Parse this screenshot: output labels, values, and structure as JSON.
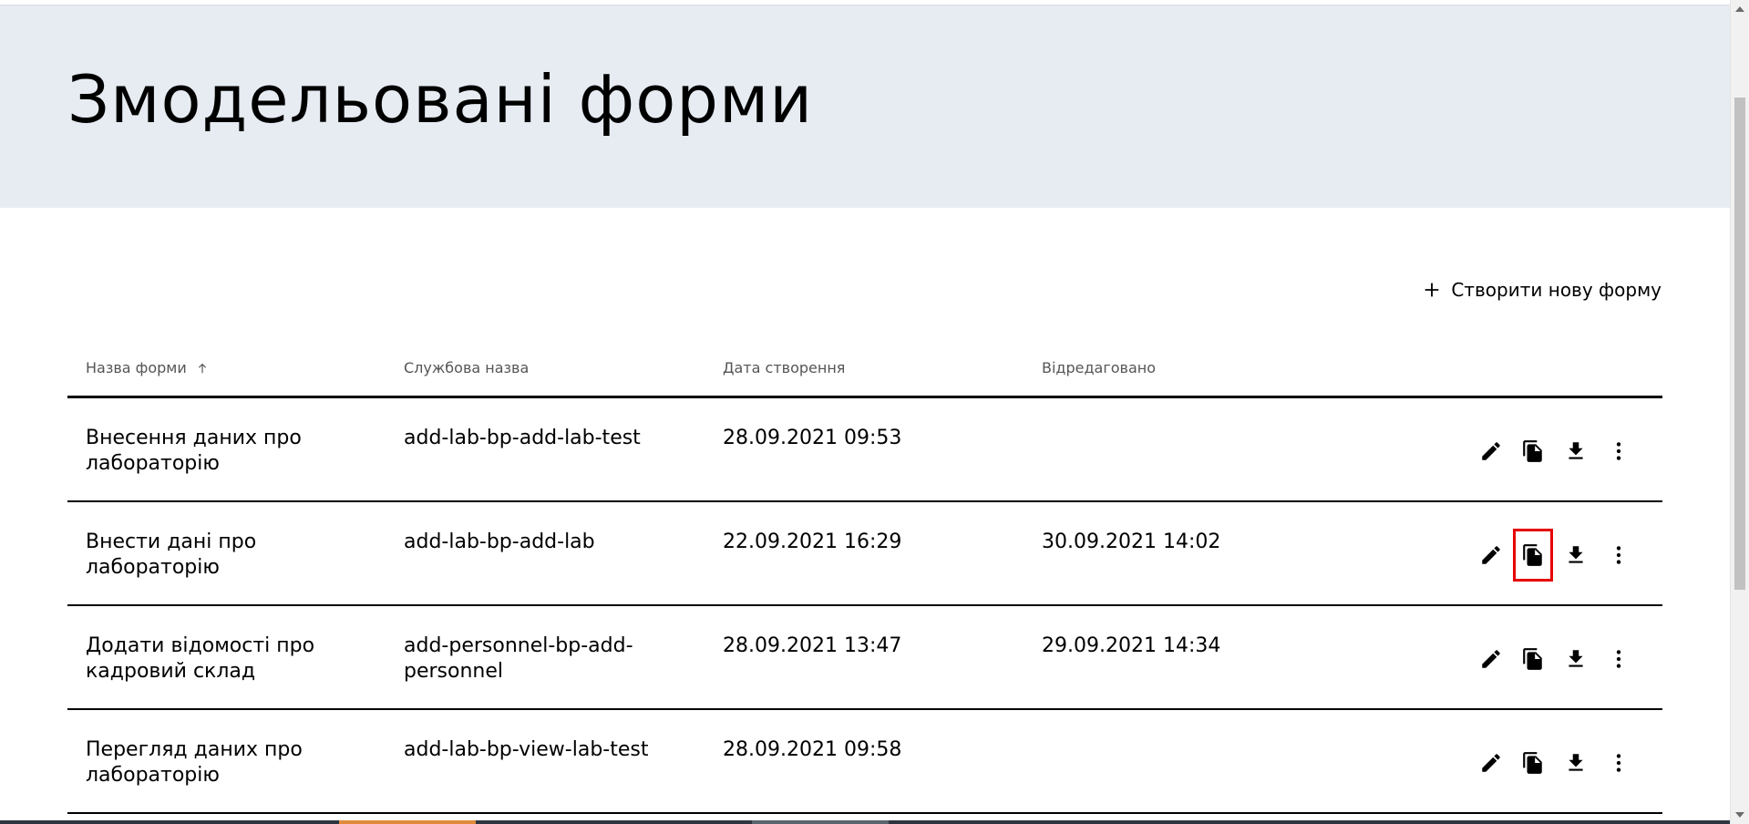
{
  "page": {
    "title": "Змодельовані форми"
  },
  "toolbar": {
    "create_label": "Створити нову форму",
    "create_icon": "plus-icon"
  },
  "table": {
    "columns": [
      {
        "key": "name",
        "label": "Назва форми",
        "sort": "asc",
        "sort_icon": "arrow-up-icon"
      },
      {
        "key": "service_name",
        "label": "Службова назва"
      },
      {
        "key": "created",
        "label": "Дата створення"
      },
      {
        "key": "edited",
        "label": "Відредаговано"
      }
    ],
    "rows": [
      {
        "name": "Внесення даних про лабораторію",
        "service_name": "add-lab-bp-add-lab-test",
        "created": "28.09.2021 09:53",
        "edited": ""
      },
      {
        "name": "Внести дані про лабораторію",
        "service_name": "add-lab-bp-add-lab",
        "created": "22.09.2021 16:29",
        "edited": "30.09.2021 14:02"
      },
      {
        "name": "Додати відомості про кадровий склад",
        "service_name": "add-personnel-bp-add-personnel",
        "created": "28.09.2021 13:47",
        "edited": "29.09.2021 14:34"
      },
      {
        "name": "Перегляд даних про лабораторію",
        "service_name": "add-lab-bp-view-lab-test",
        "created": "28.09.2021 09:58",
        "edited": ""
      }
    ],
    "row_actions": [
      "pencil-icon",
      "copy-icon",
      "download-icon",
      "more-vertical-icon"
    ],
    "highlighted_action": {
      "row": 1,
      "action": "copy-icon",
      "color": "#e60000"
    }
  },
  "colors": {
    "header_background": "#e6ecf2",
    "text": "#000000",
    "column_header_text": "#555555",
    "highlight": "#e60000"
  }
}
